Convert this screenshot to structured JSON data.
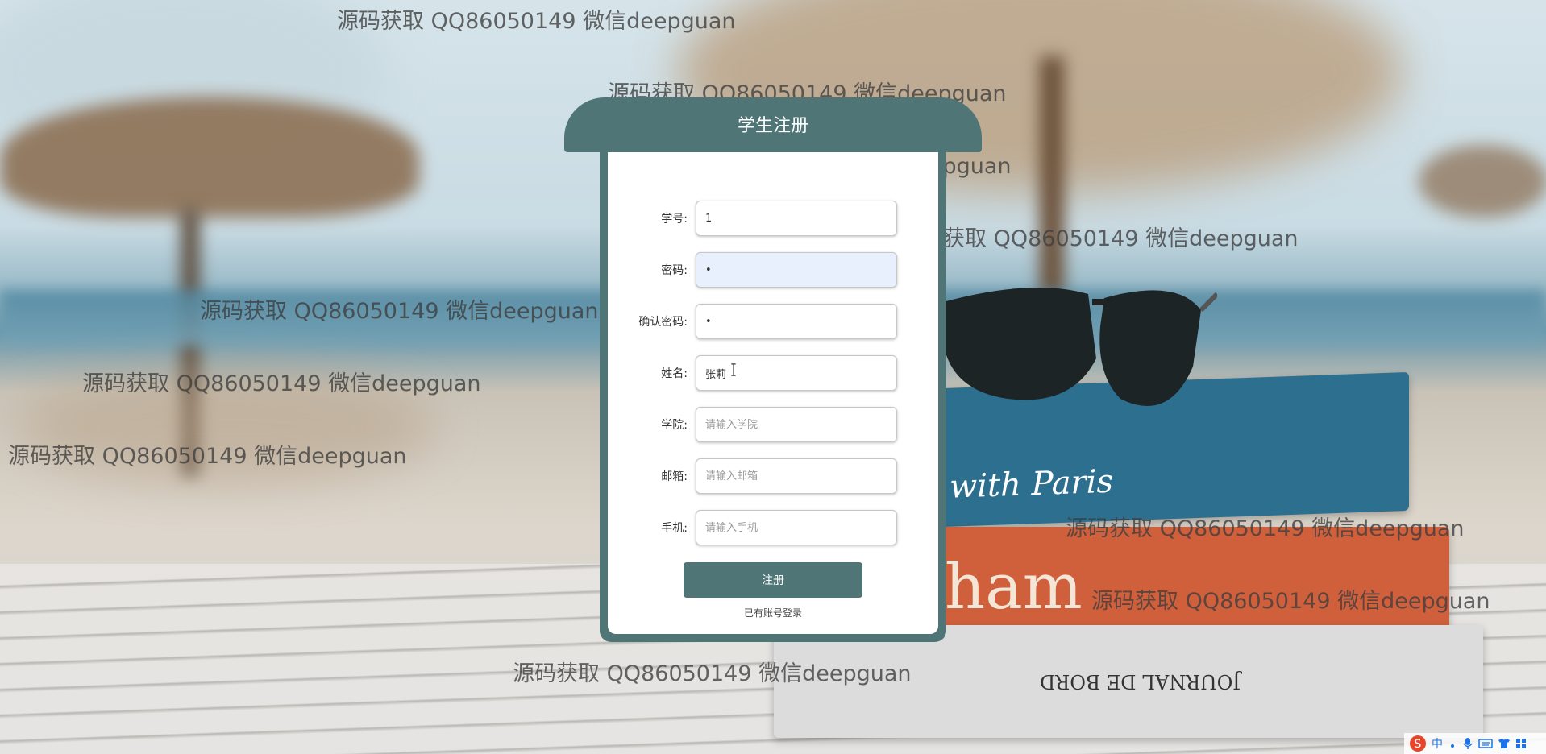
{
  "form": {
    "title": "学生注册",
    "fields": [
      {
        "label": "学号:",
        "value": "1",
        "placeholder": ""
      },
      {
        "label": "密码:",
        "value": "•",
        "placeholder": ""
      },
      {
        "label": "确认密码:",
        "value": "•",
        "placeholder": ""
      },
      {
        "label": "姓名:",
        "value": "张莉",
        "placeholder": ""
      },
      {
        "label": "学院:",
        "value": "",
        "placeholder": "请输入学院"
      },
      {
        "label": "邮箱:",
        "value": "",
        "placeholder": "请输入邮箱"
      },
      {
        "label": "手机:",
        "value": "",
        "placeholder": "请输入手机"
      }
    ],
    "submit_label": "注册",
    "login_link": "已有账号登录"
  },
  "watermarks": [
    "源码获取 QQ86050149 微信deepguan",
    "源码获取 QQ86050149 微信deepguan",
    "源码获取 QQ86050149 微信deepguan",
    "源码获取 QQ86050149 微信deepguan",
    "源码获取 QQ86050149 微信deepguan",
    "源码获取 QQ86050149 微信deepguan",
    "源码获取 QQ86050149 微信deepguan",
    "源码获取 QQ86050149 微信deepguan",
    "源码获取 QQ86050149 微信deepguan",
    "源码获取 QQ86050149 微信deepguan"
  ],
  "background": {
    "book_titles": [
      "with Paris",
      "ham",
      "JOURNAL DE BORD"
    ]
  },
  "ime_tray": {
    "logo": "S",
    "mode": "中",
    "icons": [
      "dot-icon",
      "mic-icon",
      "keyboard-icon",
      "shirt-icon",
      "grid-icon"
    ]
  },
  "colors": {
    "panel": "#4f7577",
    "field_autofill": "#e8f0fe"
  }
}
